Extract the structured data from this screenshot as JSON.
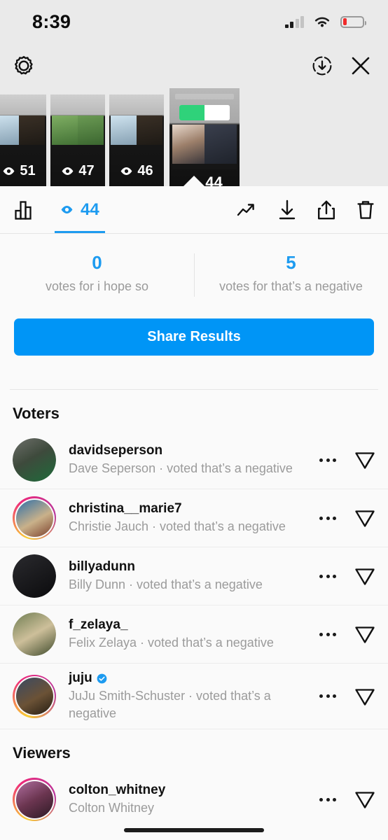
{
  "status_bar": {
    "time": "8:39",
    "signal_icon": "cellular-signal-icon",
    "signal_bars_filled": 2,
    "signal_bars_total": 4,
    "wifi_icon": "wifi-icon",
    "battery_icon": "battery-low-icon",
    "battery_level_percent": 8,
    "battery_color": "#f12a2a"
  },
  "nav_bar": {
    "settings_icon": "gear-icon",
    "save_icon": "download-circle-icon",
    "close_icon": "close-icon"
  },
  "story_strip": {
    "thumbnails": [
      {
        "views": "51",
        "selected": false,
        "eye_icon": "eye-icon"
      },
      {
        "views": "47",
        "selected": false,
        "eye_icon": "eye-icon"
      },
      {
        "views": "46",
        "selected": false,
        "eye_icon": "eye-icon"
      },
      {
        "views": "44",
        "selected": true,
        "eye_icon": "eye-icon"
      }
    ]
  },
  "toolbar": {
    "insights_icon": "bar-chart-icon",
    "views_eye_icon": "eye-icon",
    "views_count": "44",
    "views_count_color": "#1d9bf0",
    "actions": [
      {
        "name": "insights-trending-icon",
        "icon": "trending-up-icon"
      },
      {
        "name": "download-button",
        "icon": "download-arrow-icon"
      },
      {
        "name": "share-button",
        "icon": "share-up-icon"
      },
      {
        "name": "delete-button",
        "icon": "trash-icon"
      }
    ]
  },
  "poll": {
    "options": [
      {
        "count": "0",
        "label": "votes for i hope so"
      },
      {
        "count": "5",
        "label": "votes for that’s a negative"
      }
    ],
    "count_color": "#1d9bf0",
    "share_results_label": "Share Results",
    "share_button_color": "#0095f6"
  },
  "voters": {
    "title": "Voters",
    "items": [
      {
        "username": "davidseperson",
        "subtitle": "Dave Seperson · voted that’s a negative",
        "verified": false,
        "has_story_ring": false,
        "avatar_class": "p-dave"
      },
      {
        "username": "christina__marie7",
        "subtitle": "Christie Jauch · voted that’s a negative",
        "verified": false,
        "has_story_ring": true,
        "avatar_class": "p-christie"
      },
      {
        "username": "billyadunn",
        "subtitle": "Billy Dunn · voted that’s a negative",
        "verified": false,
        "has_story_ring": false,
        "avatar_class": "p-billy"
      },
      {
        "username": "f_zelaya_",
        "subtitle": "Felix Zelaya · voted that’s a negative",
        "verified": false,
        "has_story_ring": false,
        "avatar_class": "p-felix"
      },
      {
        "username": "juju",
        "subtitle": "JuJu Smith-Schuster · voted that’s a negative",
        "verified": true,
        "has_story_ring": true,
        "avatar_class": "p-juju"
      }
    ]
  },
  "viewers": {
    "title": "Viewers",
    "items": [
      {
        "username": "colton_whitney",
        "subtitle": "Colton Whitney",
        "verified": false,
        "has_story_ring": true,
        "avatar_class": "p-colton"
      }
    ]
  },
  "row_actions": {
    "more_icon": "more-options-icon",
    "send_icon": "send-message-icon"
  }
}
